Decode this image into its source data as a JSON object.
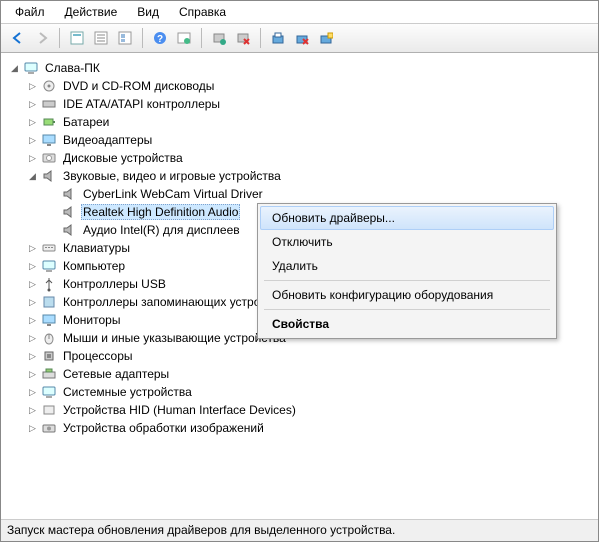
{
  "menu": {
    "file": "Файл",
    "action": "Действие",
    "view": "Вид",
    "help": "Справка"
  },
  "tree": {
    "root": "Слава-ПК",
    "items": [
      {
        "label": "DVD и CD-ROM дисководы"
      },
      {
        "label": "IDE ATA/ATAPI контроллеры"
      },
      {
        "label": "Батареи"
      },
      {
        "label": "Видеоадаптеры"
      },
      {
        "label": "Дисковые устройства"
      },
      {
        "label": "Звуковые, видео и игровые устройства",
        "expanded": true,
        "children": [
          {
            "label": "CyberLink WebCam Virtual Driver"
          },
          {
            "label": "Realtek High Definition Audio",
            "selected": true
          },
          {
            "label": "Аудио Intel(R) для дисплеев"
          }
        ]
      },
      {
        "label": "Клавиатуры"
      },
      {
        "label": "Компьютер"
      },
      {
        "label": "Контроллеры USB"
      },
      {
        "label": "Контроллеры запоминающих устройств"
      },
      {
        "label": "Мониторы"
      },
      {
        "label": "Мыши и иные указывающие устройства"
      },
      {
        "label": "Процессоры"
      },
      {
        "label": "Сетевые адаптеры"
      },
      {
        "label": "Системные устройства"
      },
      {
        "label": "Устройства HID (Human Interface Devices)"
      },
      {
        "label": "Устройства обработки изображений"
      }
    ]
  },
  "context_menu": {
    "update": "Обновить драйверы...",
    "disable": "Отключить",
    "delete": "Удалить",
    "rescan": "Обновить конфигурацию оборудования",
    "properties": "Свойства"
  },
  "status": "Запуск мастера обновления драйверов для выделенного устройства."
}
